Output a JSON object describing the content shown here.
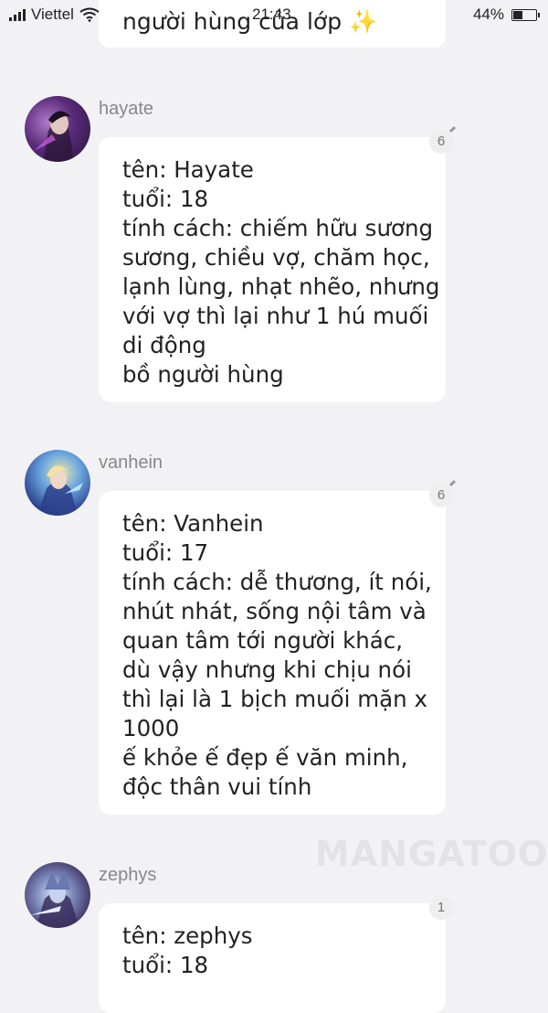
{
  "status_bar": {
    "carrier": "Viettel",
    "time": "21:43",
    "battery_percent": "44%",
    "battery_level": 0.44
  },
  "top_bubble": {
    "text": "người hùng của lớp",
    "emoji": "✨"
  },
  "messages": [
    {
      "username": "hayate",
      "avatar": "hayate-avatar",
      "comment_count": "6",
      "lines": [
        "tên: Hayate",
        "tuổi: 18",
        "tính cách: chiếm hữu sương",
        "sương, chiều vợ, chăm học,",
        "lạnh lùng, nhạt nhẽo, nhưng",
        "với vợ thì lại như 1 hú muối",
        "di động",
        "bồ người hùng"
      ]
    },
    {
      "username": "vanhein",
      "avatar": "vanhein-avatar",
      "comment_count": "6",
      "lines": [
        "tên: Vanhein",
        "tuổi: 17",
        "tính cách: dễ thương, ít nói,",
        "nhút nhát, sống nội tâm và",
        "quan tâm tới người khác,",
        "dù vậy nhưng khi chịu nói",
        "thì lại là 1 bịch muối mặn x",
        "1000",
        "ế khỏe ế đẹp ế văn minh,",
        "độc thân vui tính"
      ]
    },
    {
      "username": "zephys",
      "avatar": "zephys-avatar",
      "comment_count": "1",
      "lines": [
        "tên: zephys",
        "tuổi: 18"
      ]
    }
  ],
  "watermark": "MANGATOON"
}
